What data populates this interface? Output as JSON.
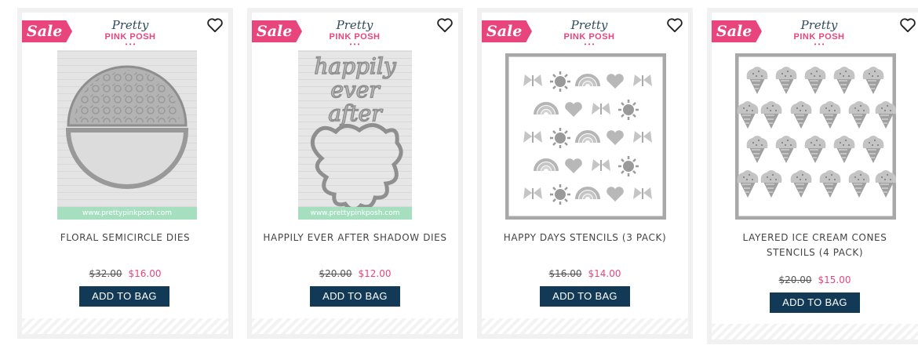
{
  "brand": {
    "line1": "Pretty",
    "line2": "PINK POSH"
  },
  "colors": {
    "sale": "#e8457c",
    "button": "#123a57",
    "price_sale": "#e8457c"
  },
  "products": [
    {
      "badge": "Sale",
      "title": "FLORAL SEMICIRCLE DIES",
      "old_price": "$32.00",
      "new_price": "$16.00",
      "button": "ADD TO BAG",
      "image_footer": "www.prettypinkposh.com",
      "image": "floral-semicircle-dies"
    },
    {
      "badge": "Sale",
      "title": "HAPPILY EVER AFTER SHADOW DIES",
      "old_price": "$20.00",
      "new_price": "$12.00",
      "button": "ADD TO BAG",
      "image_footer": "www.prettypinkposh.com",
      "image": "happily-ever-after-dies",
      "image_text": "happily ever after"
    },
    {
      "badge": "Sale",
      "title": "HAPPY DAYS STENCILS (3 PACK)",
      "old_price": "$16.00",
      "new_price": "$14.00",
      "button": "ADD TO BAG",
      "image": "happy-days-stencils"
    },
    {
      "badge": "Sale",
      "title": "LAYERED ICE CREAM CONES STENCILS (4 PACK)",
      "old_price": "$20.00",
      "new_price": "$15.00",
      "button": "ADD TO BAG",
      "image": "ice-cream-cones-stencils"
    }
  ]
}
